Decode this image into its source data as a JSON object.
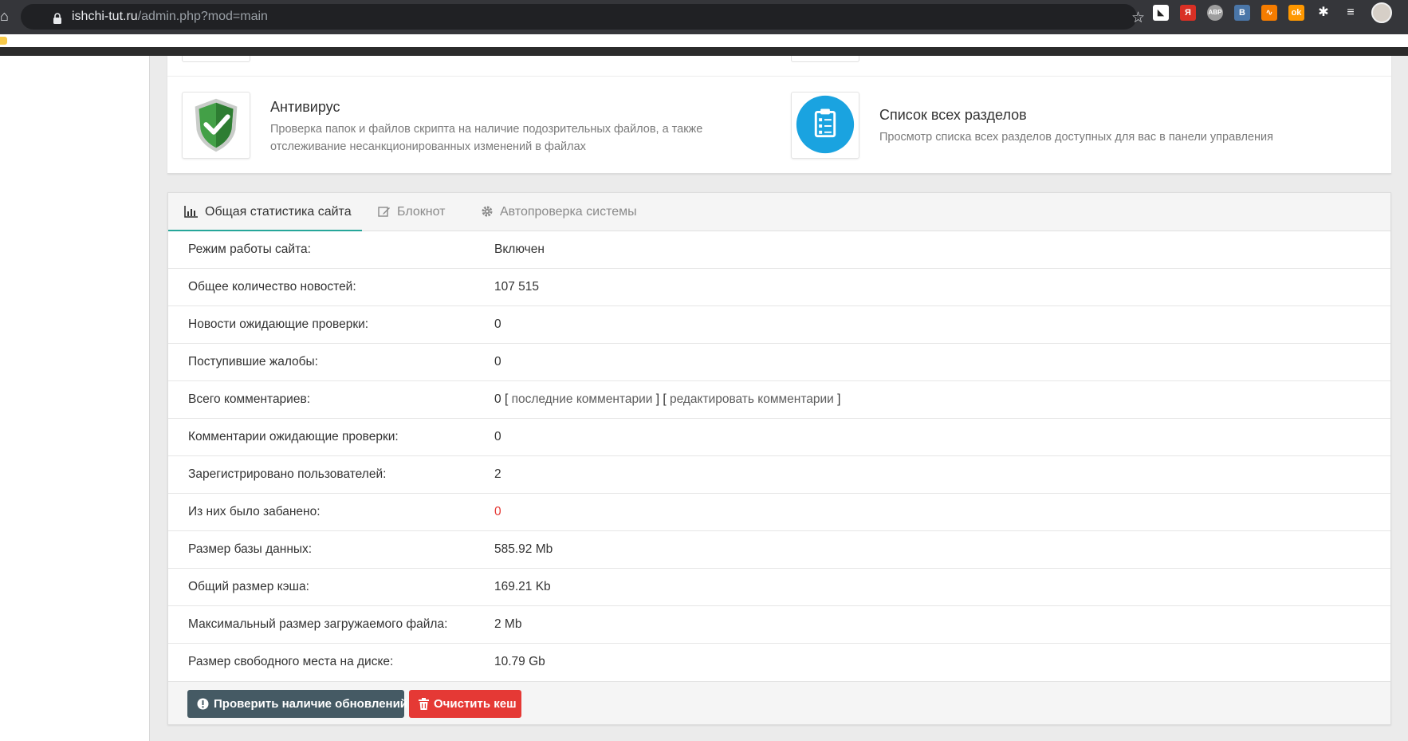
{
  "browser": {
    "url_host": "ishchi-tut.ru",
    "url_path": "/admin.php?mod=main"
  },
  "shortcuts": [
    {
      "title": "Антивирус",
      "description": "Проверка папок и файлов скрипта на наличие подозрительных файлов, а также отслеживание несанкционированных изменений в файлах",
      "icon": "shield-check-icon"
    },
    {
      "title": "Список всех разделов",
      "description": "Просмотр списка всех разделов доступных для вас в панели управления",
      "icon": "clipboard-list-icon"
    }
  ],
  "tabs": [
    {
      "label": "Общая статистика сайта",
      "icon": "bar-chart-icon",
      "active": true
    },
    {
      "label": "Блокнот",
      "icon": "edit-icon",
      "active": false
    },
    {
      "label": "Автопроверка системы",
      "icon": "gear-icon",
      "active": false
    }
  ],
  "stats": [
    {
      "label": "Режим работы сайта:",
      "value": "Включен"
    },
    {
      "label": "Общее количество новостей:",
      "value": "107 515"
    },
    {
      "label": "Новости ожидающие проверки:",
      "value": "0"
    },
    {
      "label": "Поступившие жалобы:",
      "value": "0"
    },
    {
      "label": "Всего комментариев:",
      "value": "0",
      "links": [
        "последние комментарии",
        "редактировать комментарии"
      ]
    },
    {
      "label": "Комментарии ожидающие проверки:",
      "value": "0"
    },
    {
      "label": "Зарегистрировано пользователей:",
      "value": "2"
    },
    {
      "label": "Из них было забанено:",
      "value": "0"
    },
    {
      "label": "Размер базы данных:",
      "value": "585.92 Mb"
    },
    {
      "label": "Общий размер кэша:",
      "value": "169.21 Kb"
    },
    {
      "label": "Максимальный размер загружаемого файла:",
      "value": "2 Mb"
    },
    {
      "label": "Размер свободного места на диске:",
      "value": "10.79 Gb"
    }
  ],
  "buttons": {
    "check_updates": "Проверить наличие обновлений",
    "clear_cache": "Очистить кеш"
  },
  "colors": {
    "tab_accent": "#26a69a",
    "update_button": "#455a64",
    "cache_button": "#e53935",
    "banned_value": "#e53935",
    "clipboard_icon_bg": "#1aa3e0",
    "shield_green": "#43a047"
  }
}
